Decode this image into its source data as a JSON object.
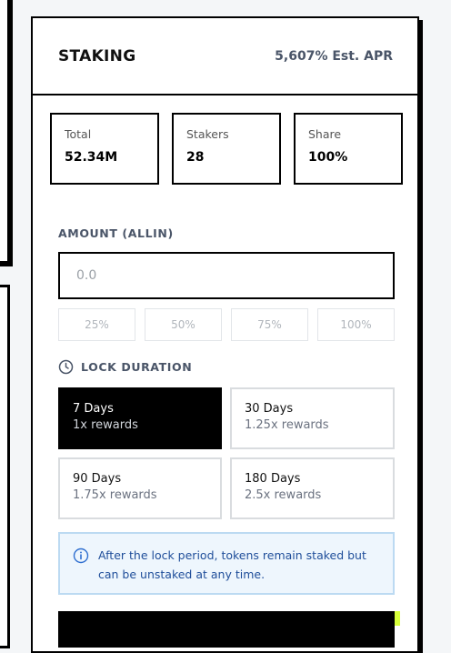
{
  "header": {
    "title": "STAKING",
    "apr": "5,607% Est. APR"
  },
  "stats": [
    {
      "label": "Total",
      "value": "52.34M"
    },
    {
      "label": "Stakers",
      "value": "28"
    },
    {
      "label": "Share",
      "value": "100%"
    }
  ],
  "amount": {
    "label": "AMOUNT (ALLIN)",
    "placeholder": "0.0",
    "value": ""
  },
  "percent_buttons": [
    "25%",
    "50%",
    "75%",
    "100%"
  ],
  "lock": {
    "label": "LOCK DURATION",
    "icon": "clock-icon",
    "options": [
      {
        "name": "7 Days",
        "rewards": "1x rewards",
        "selected": true
      },
      {
        "name": "30 Days",
        "rewards": "1.25x rewards",
        "selected": false
      },
      {
        "name": "90 Days",
        "rewards": "1.75x rewards",
        "selected": false
      },
      {
        "name": "180 Days",
        "rewards": "2.5x rewards",
        "selected": false
      }
    ]
  },
  "info": {
    "icon": "info-icon",
    "text": "After the lock period, tokens remain staked but can be unstaked at any time."
  },
  "colors": {
    "accent": "#d7ff3a",
    "info_bg": "#eef6fd",
    "info_text": "#1f4e9a",
    "border": "#000000"
  }
}
